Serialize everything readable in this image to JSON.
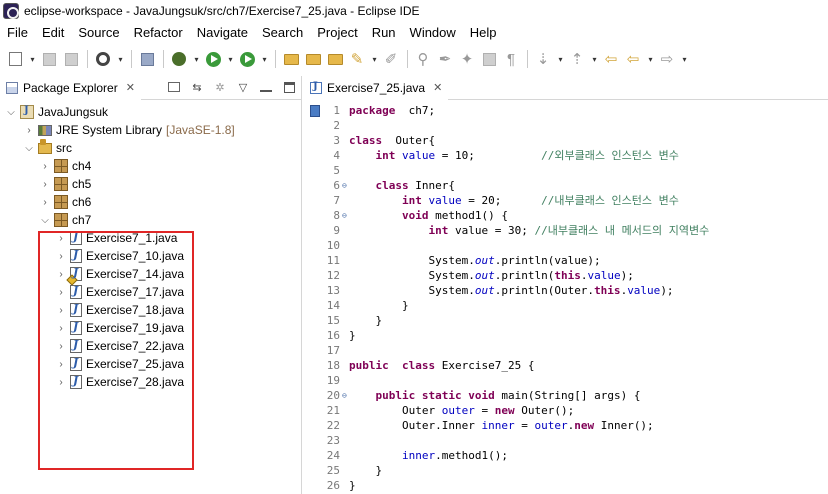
{
  "window": {
    "title": "eclipse-workspace - JavaJungsuk/src/ch7/Exercise7_25.java - Eclipse IDE"
  },
  "menubar": [
    "File",
    "Edit",
    "Source",
    "Refactor",
    "Navigate",
    "Search",
    "Project",
    "Run",
    "Window",
    "Help"
  ],
  "toolbar": {
    "icons": [
      "new-icon",
      "save-icon",
      "save-all-icon",
      "target-icon",
      "console-icon",
      "debug-icon",
      "run-icon",
      "run-external-icon",
      "open-type-icon",
      "open-folder-icon",
      "open-resource-icon",
      "search-task-icon",
      "pin-icon",
      "edit-icon",
      "annotation-icon",
      "toggle-mark-icon",
      "block-icon",
      "paragraph-icon",
      "next-annotation-icon",
      "prev-annotation-icon",
      "last-edit-icon",
      "back-icon",
      "forward-icon"
    ]
  },
  "package_explorer": {
    "tab_label": "Package Explorer",
    "project": {
      "name": "JavaJungsuk"
    },
    "library": {
      "name": "JRE System Library",
      "version": "[JavaSE-1.8]"
    },
    "src": {
      "name": "src"
    },
    "packages": [
      "ch4",
      "ch5",
      "ch6",
      "ch7"
    ],
    "ch7_files": [
      "Exercise7_1.java",
      "Exercise7_10.java",
      "Exercise7_14.java",
      "Exercise7_17.java",
      "Exercise7_18.java",
      "Exercise7_19.java",
      "Exercise7_22.java",
      "Exercise7_25.java",
      "Exercise7_28.java"
    ]
  },
  "editor": {
    "tab_label": "Exercise7_25.java",
    "lines": [
      {
        "n": "1",
        "fold": "",
        "tokens": [
          [
            "kw",
            "package"
          ],
          [
            "",
            "  ch7;"
          ]
        ]
      },
      {
        "n": "2",
        "fold": "",
        "tokens": []
      },
      {
        "n": "3",
        "fold": "",
        "tokens": [
          [
            "kw",
            "class"
          ],
          [
            "",
            "  Outer{"
          ]
        ]
      },
      {
        "n": "4",
        "fold": "",
        "tokens": [
          [
            "",
            "    "
          ],
          [
            "kw",
            "int"
          ],
          [
            "",
            " "
          ],
          [
            "field",
            "value"
          ],
          [
            "",
            " = 10;          "
          ],
          [
            "comment",
            "//외부클래스 인스턴스 변수"
          ]
        ]
      },
      {
        "n": "5",
        "fold": "",
        "tokens": []
      },
      {
        "n": "6",
        "fold": "⊖",
        "tokens": [
          [
            "",
            "    "
          ],
          [
            "kw",
            "class"
          ],
          [
            "",
            " Inner{"
          ]
        ]
      },
      {
        "n": "7",
        "fold": "",
        "tokens": [
          [
            "",
            "        "
          ],
          [
            "kw",
            "int"
          ],
          [
            "",
            " "
          ],
          [
            "field",
            "value"
          ],
          [
            "",
            " = 20;      "
          ],
          [
            "comment",
            "//내부클래스 인스턴스 변수"
          ]
        ]
      },
      {
        "n": "8",
        "fold": "⊖",
        "tokens": [
          [
            "",
            "        "
          ],
          [
            "kw",
            "void"
          ],
          [
            "",
            " method1() {"
          ]
        ]
      },
      {
        "n": "9",
        "fold": "",
        "tokens": [
          [
            "",
            "            "
          ],
          [
            "kw",
            "int"
          ],
          [
            "",
            " value = 30; "
          ],
          [
            "comment",
            "//내부클래스 내 메서드의 지역변수"
          ]
        ]
      },
      {
        "n": "10",
        "fold": "",
        "tokens": []
      },
      {
        "n": "11",
        "fold": "",
        "tokens": [
          [
            "",
            "            System."
          ],
          [
            "static",
            "out"
          ],
          [
            "",
            ".println(value);"
          ]
        ]
      },
      {
        "n": "12",
        "fold": "",
        "tokens": [
          [
            "",
            "            System."
          ],
          [
            "static",
            "out"
          ],
          [
            "",
            ".println("
          ],
          [
            "kw",
            "this"
          ],
          [
            "",
            "."
          ],
          [
            "field",
            "value"
          ],
          [
            "",
            ");"
          ]
        ]
      },
      {
        "n": "13",
        "fold": "",
        "tokens": [
          [
            "",
            "            System."
          ],
          [
            "static",
            "out"
          ],
          [
            "",
            ".println(Outer."
          ],
          [
            "kw",
            "this"
          ],
          [
            "",
            "."
          ],
          [
            "field",
            "value"
          ],
          [
            "",
            ");"
          ]
        ]
      },
      {
        "n": "14",
        "fold": "",
        "tokens": [
          [
            "",
            "        }"
          ]
        ]
      },
      {
        "n": "15",
        "fold": "",
        "tokens": [
          [
            "",
            "    }"
          ]
        ]
      },
      {
        "n": "16",
        "fold": "",
        "tokens": [
          [
            "",
            "}"
          ]
        ]
      },
      {
        "n": "17",
        "fold": "",
        "tokens": []
      },
      {
        "n": "18",
        "fold": "",
        "tokens": [
          [
            "kw",
            "public"
          ],
          [
            "",
            "  "
          ],
          [
            "kw",
            "class"
          ],
          [
            "",
            " Exercise7_25 {"
          ]
        ]
      },
      {
        "n": "19",
        "fold": "",
        "tokens": []
      },
      {
        "n": "20",
        "fold": "⊖",
        "tokens": [
          [
            "",
            "    "
          ],
          [
            "kw",
            "public"
          ],
          [
            "",
            " "
          ],
          [
            "kw",
            "static"
          ],
          [
            "",
            " "
          ],
          [
            "kw",
            "void"
          ],
          [
            "",
            " main(String[] args) {"
          ]
        ]
      },
      {
        "n": "21",
        "fold": "",
        "tokens": [
          [
            "",
            "        Outer "
          ],
          [
            "field",
            "outer"
          ],
          [
            "",
            " = "
          ],
          [
            "kw",
            "new"
          ],
          [
            "",
            " Outer();"
          ]
        ]
      },
      {
        "n": "22",
        "fold": "",
        "tokens": [
          [
            "",
            "        Outer.Inner "
          ],
          [
            "field",
            "inner"
          ],
          [
            "",
            " = "
          ],
          [
            "field",
            "outer"
          ],
          [
            "",
            "."
          ],
          [
            "kw",
            "new"
          ],
          [
            "",
            " Inner();"
          ]
        ]
      },
      {
        "n": "23",
        "fold": "",
        "tokens": []
      },
      {
        "n": "24",
        "fold": "",
        "tokens": [
          [
            "",
            "        "
          ],
          [
            "field",
            "inner"
          ],
          [
            "",
            ".method1();"
          ]
        ]
      },
      {
        "n": "25",
        "fold": "",
        "tokens": [
          [
            "",
            "    }"
          ]
        ]
      },
      {
        "n": "26",
        "fold": "",
        "tokens": [
          [
            "",
            "}"
          ]
        ]
      }
    ]
  }
}
